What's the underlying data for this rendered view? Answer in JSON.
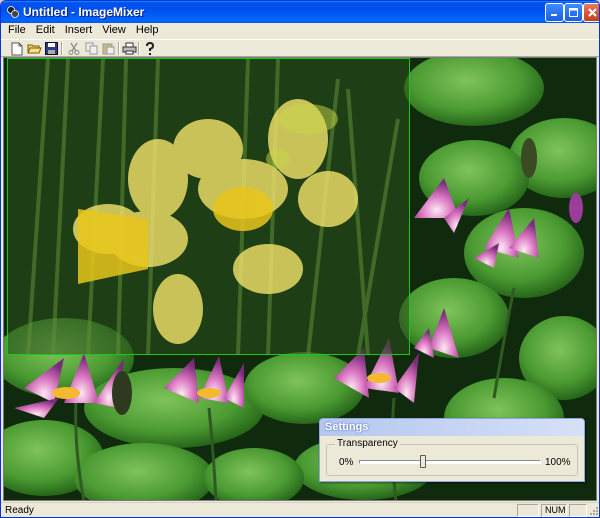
{
  "window": {
    "title": "Untitled - ImageMixer",
    "app_icon": "imagemixer-app-icon",
    "controls": [
      "minimize-icon",
      "maximize-icon",
      "close-icon"
    ]
  },
  "menu": {
    "items": [
      {
        "label": "File"
      },
      {
        "label": "Edit"
      },
      {
        "label": "Insert"
      },
      {
        "label": "View"
      },
      {
        "label": "Help"
      }
    ]
  },
  "toolbar": {
    "buttons": [
      {
        "icon": "new-document-icon"
      },
      {
        "icon": "open-folder-icon"
      },
      {
        "icon": "save-icon"
      },
      {
        "icon": "cut-icon"
      },
      {
        "icon": "copy-icon"
      },
      {
        "icon": "paste-icon"
      },
      {
        "icon": "print-icon"
      },
      {
        "icon": "help-icon"
      }
    ]
  },
  "canvas": {
    "background_image": "water-lilies-photo",
    "overlay_image": "daffodil-photo",
    "overlay_border_color": "#1bc91b"
  },
  "settings": {
    "title": "Settings",
    "group_label": "Transparency",
    "min_label": "0%",
    "max_label": "100%",
    "transparency_fraction": 0.35
  },
  "statusbar": {
    "text": "Ready",
    "pane_2": "NUM"
  },
  "colors": {
    "titlebar_blue": "#0053ee",
    "window_face": "#ece9d8",
    "settings_title": "#b5c7ef"
  }
}
